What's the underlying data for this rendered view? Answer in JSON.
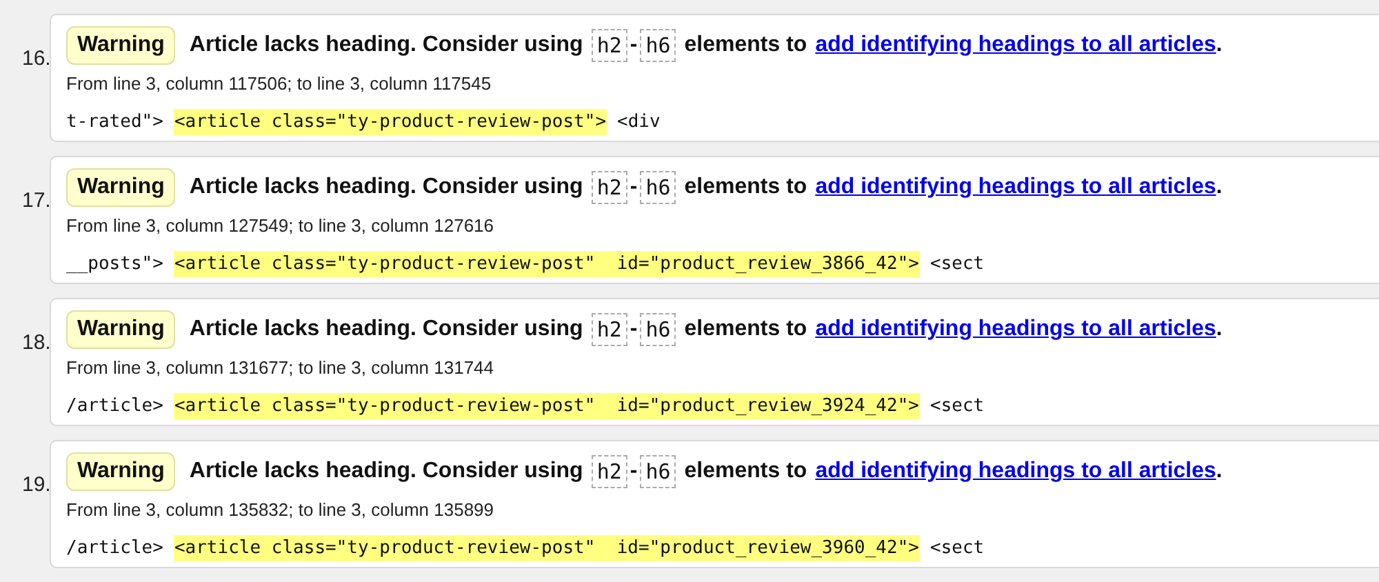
{
  "messages": [
    {
      "number": "16.",
      "type": "Warning",
      "text_before": "Article lacks heading. Consider using",
      "code_start": "h2",
      "range_dash": "-",
      "code_end": "h6",
      "text_after": "elements to",
      "link": "add identifying headings to all articles",
      "period": ".",
      "location": "From line 3, column 117506; to line 3, column 117545",
      "extract_before": "t-rated\">",
      "extract_highlight": "<article class=\"ty-product-review-post\">",
      "extract_after": "<div"
    },
    {
      "number": "17.",
      "type": "Warning",
      "text_before": "Article lacks heading. Consider using",
      "code_start": "h2",
      "range_dash": "-",
      "code_end": "h6",
      "text_after": "elements to",
      "link": "add identifying headings to all articles",
      "period": ".",
      "location": "From line 3, column 127549; to line 3, column 127616",
      "extract_before": "__posts\">",
      "extract_highlight": "<article class=\"ty-product-review-post\"  id=\"product_review_3866_42\">",
      "extract_after": "<sect"
    },
    {
      "number": "18.",
      "type": "Warning",
      "text_before": "Article lacks heading. Consider using",
      "code_start": "h2",
      "range_dash": "-",
      "code_end": "h6",
      "text_after": "elements to",
      "link": "add identifying headings to all articles",
      "period": ".",
      "location": "From line 3, column 131677; to line 3, column 131744",
      "extract_before": "/article>",
      "extract_highlight": "<article class=\"ty-product-review-post\"  id=\"product_review_3924_42\">",
      "extract_after": "<sect"
    },
    {
      "number": "19.",
      "type": "Warning",
      "text_before": "Article lacks heading. Consider using",
      "code_start": "h2",
      "range_dash": "-",
      "code_end": "h6",
      "text_after": "elements to",
      "link": "add identifying headings to all articles",
      "period": ".",
      "location": "From line 3, column 135832; to line 3, column 135899",
      "extract_before": "/article>",
      "extract_highlight": "<article class=\"ty-product-review-post\"  id=\"product_review_3960_42\">",
      "extract_after": "<sect"
    }
  ]
}
